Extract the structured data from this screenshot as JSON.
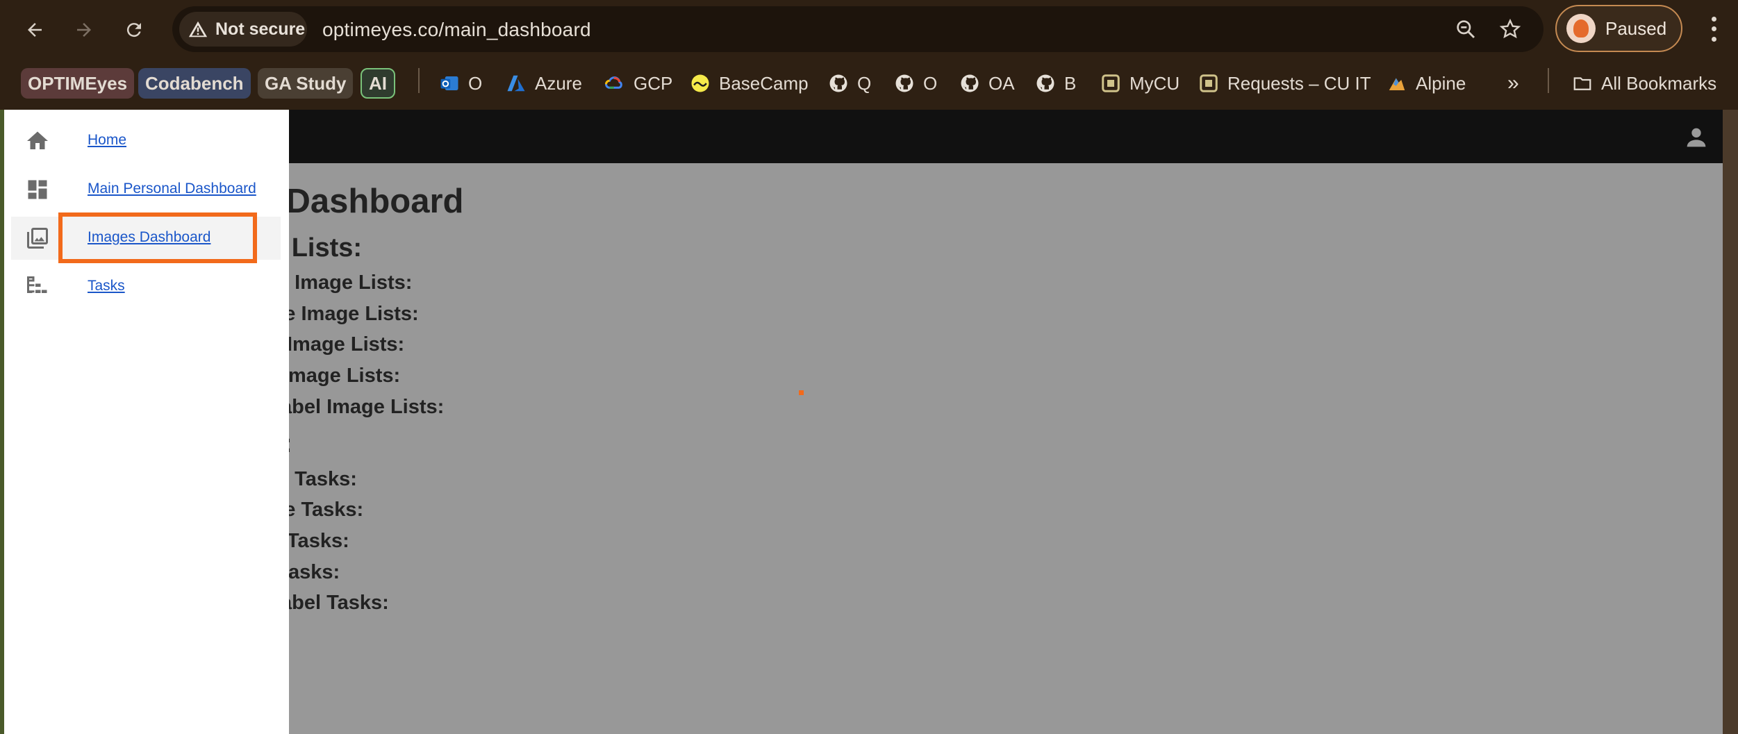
{
  "browser": {
    "security_label": "Not secure",
    "url": "optimeyes.co/main_dashboard",
    "profile_label": "Paused"
  },
  "bookmarks": [
    {
      "label": "OPTIMEyes",
      "chip_color": "#5c3b3a"
    },
    {
      "label": "Codabench",
      "chip_color": "#3a4563"
    },
    {
      "label": "GA Study",
      "chip_color": "#4a3f33"
    },
    {
      "label": "AI",
      "chip_color": "#2f3b2e"
    },
    {
      "label": "O",
      "icon": "outlook-icon"
    },
    {
      "label": "Azure",
      "icon": "azure-icon"
    },
    {
      "label": "GCP",
      "icon": "gcp-icon"
    },
    {
      "label": "BaseCamp",
      "icon": "basecamp-icon"
    },
    {
      "label": "Q",
      "icon": "github-icon"
    },
    {
      "label": "O",
      "icon": "github-icon"
    },
    {
      "label": "OA",
      "icon": "github-icon"
    },
    {
      "label": "B",
      "icon": "github-icon"
    },
    {
      "label": "MyCU",
      "icon": "cu-icon"
    },
    {
      "label": "Requests – CU IT",
      "icon": "cu-icon"
    },
    {
      "label": "Alpine",
      "icon": "alpine-icon"
    },
    {
      "label": "All Bookmarks",
      "icon": "folder-icon"
    }
  ],
  "overflow_label": "»",
  "page": {
    "title": "n Dashboard",
    "sections": [
      "e Lists:",
      "y Image Lists:",
      "re Image Lists:",
      "Image Lists:",
      "mage Lists:",
      "abel Image Lists:",
      ":",
      "y Tasks:",
      "re Tasks:",
      "Tasks:",
      "asks:",
      "abel Tasks:"
    ]
  },
  "drawer": {
    "items": [
      {
        "label": "Home",
        "icon": "home-icon"
      },
      {
        "label": "Main Personal Dashboard",
        "icon": "dashboard-icon"
      },
      {
        "label": "Images Dashboard",
        "icon": "images-icon",
        "active": true
      },
      {
        "label": "Tasks",
        "icon": "tasks-icon"
      }
    ]
  },
  "colors": {
    "highlight": "#f26a1b",
    "link": "#1a56c9",
    "appbar": "#111111",
    "overlay": "#989898"
  }
}
